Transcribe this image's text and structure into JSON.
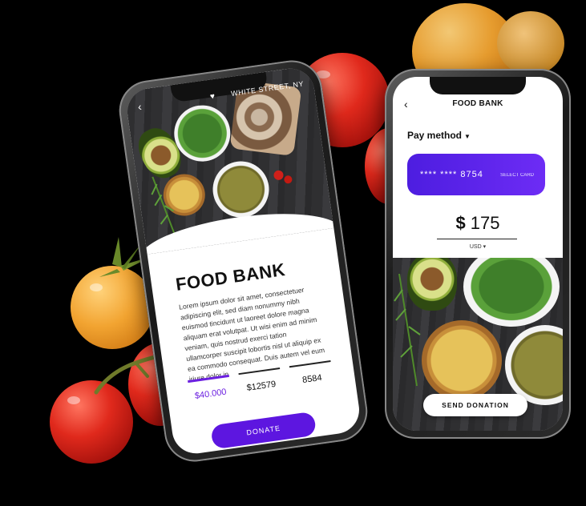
{
  "left_phone": {
    "location": "WHITE STREET, NY",
    "title": "FOOD BANK",
    "body": "Lorem ipsum dolor sit amet, consectetuer adipiscing elit, sed diam nonummy nibh euismod tincidunt ut laoreet dolore magna aliquam erat volutpat. Ut wisi enim ad minim veniam, quis nostrud exerci tation ullamcorper suscipit lobortis nisl ut aliquip ex ea commodo consequat. Duis autem vel eum iriure dolor in",
    "stats": [
      {
        "value": "$40.000",
        "active": true
      },
      {
        "value": "$12579",
        "active": false
      },
      {
        "value": "8584",
        "active": false
      }
    ],
    "donate_label": "DONATE"
  },
  "right_phone": {
    "title": "FOOD BANK",
    "pay_method_label": "Pay method",
    "card_number": "**** **** 8754",
    "select_card_label": "SELECT CARD",
    "amount_symbol": "$",
    "amount_value": "175",
    "currency": "USD",
    "send_label": "SEND DONATION"
  },
  "colors": {
    "accent": "#5d16e0",
    "card_gradient": [
      "#4d1de0",
      "#6d2cf5"
    ]
  }
}
